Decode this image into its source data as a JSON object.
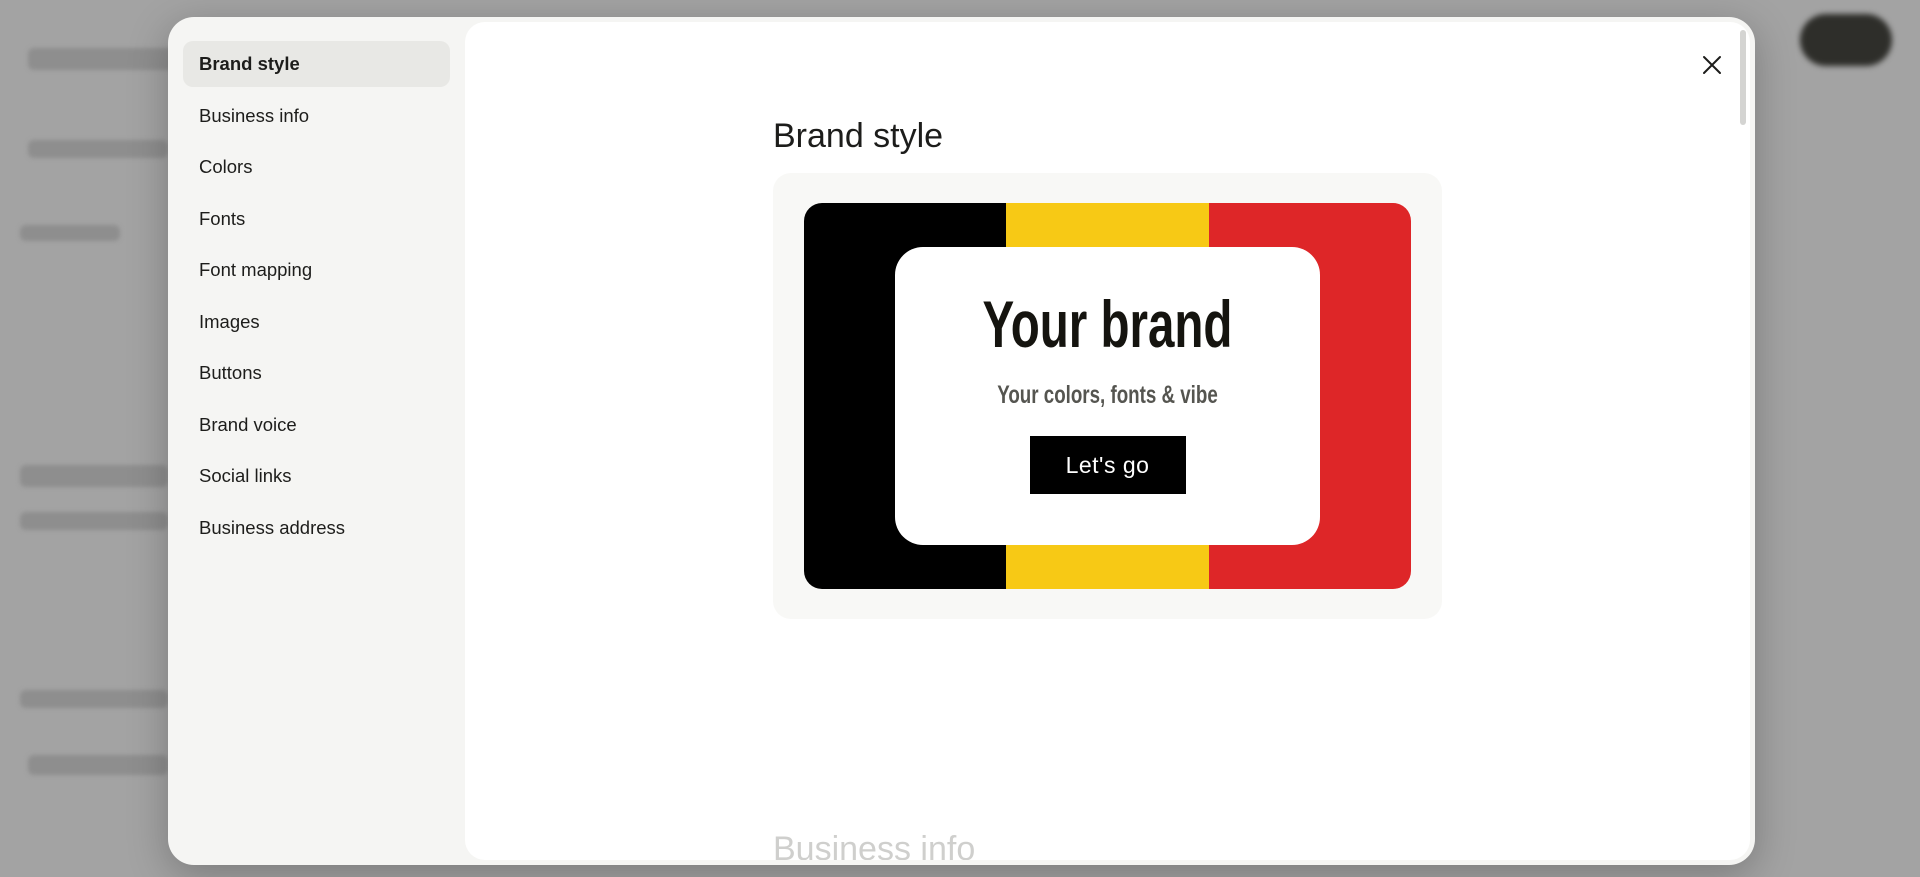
{
  "sidebar": {
    "items": [
      {
        "label": "Brand style",
        "active": true
      },
      {
        "label": "Business info"
      },
      {
        "label": "Colors"
      },
      {
        "label": "Fonts"
      },
      {
        "label": "Font mapping"
      },
      {
        "label": "Images"
      },
      {
        "label": "Buttons"
      },
      {
        "label": "Brand voice"
      },
      {
        "label": "Social links"
      },
      {
        "label": "Business address"
      }
    ]
  },
  "main": {
    "title": "Brand style",
    "close_icon": "close-icon",
    "preview": {
      "heading": "Your brand",
      "subheading": "Your colors, fonts & vibe",
      "button_label": "Let's go",
      "stripe_colors": [
        "#000000",
        "#f7c915",
        "#de2628"
      ]
    },
    "next_section_title": "Business info"
  },
  "colors": {
    "accent_dark": "#000000",
    "accent_yellow": "#f7c915",
    "accent_red": "#de2628"
  }
}
